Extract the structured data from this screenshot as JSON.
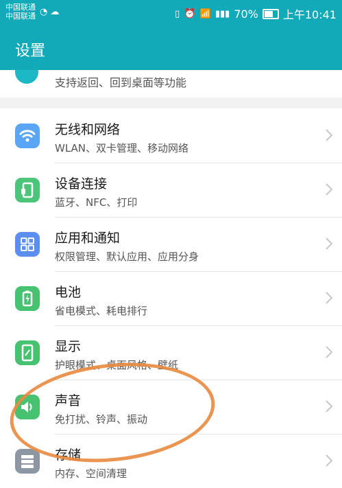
{
  "status_bar": {
    "carrier1": "中国联通",
    "carrier2": "中国联通",
    "battery_pct": "70%",
    "time": "上午10:41"
  },
  "header": {
    "title": "设置"
  },
  "items": [
    {
      "subtitle": "支持返回、回到桌面等功能"
    },
    {
      "title": "无线和网络",
      "subtitle": "WLAN、双卡管理、移动网络",
      "icon": "wifi-icon",
      "color": "#5aa6f5"
    },
    {
      "title": "设备连接",
      "subtitle": "蓝牙、NFC、打印",
      "icon": "device-connect-icon",
      "color": "#4cc47a"
    },
    {
      "title": "应用和通知",
      "subtitle": "权限管理、默认应用、应用分身",
      "icon": "apps-icon",
      "color": "#5a8ff0"
    },
    {
      "title": "电池",
      "subtitle": "省电模式、耗电排行",
      "icon": "battery-icon",
      "color": "#46c271"
    },
    {
      "title": "显示",
      "subtitle": "护眼模式、桌面风格、壁纸",
      "icon": "display-icon",
      "color": "#46c271"
    },
    {
      "title": "声音",
      "subtitle": "免打扰、铃声、振动",
      "icon": "sound-icon",
      "color": "#46c271"
    },
    {
      "title": "存储",
      "subtitle": "内存、空间清理",
      "icon": "storage-icon",
      "color": "#8d96a3"
    }
  ]
}
